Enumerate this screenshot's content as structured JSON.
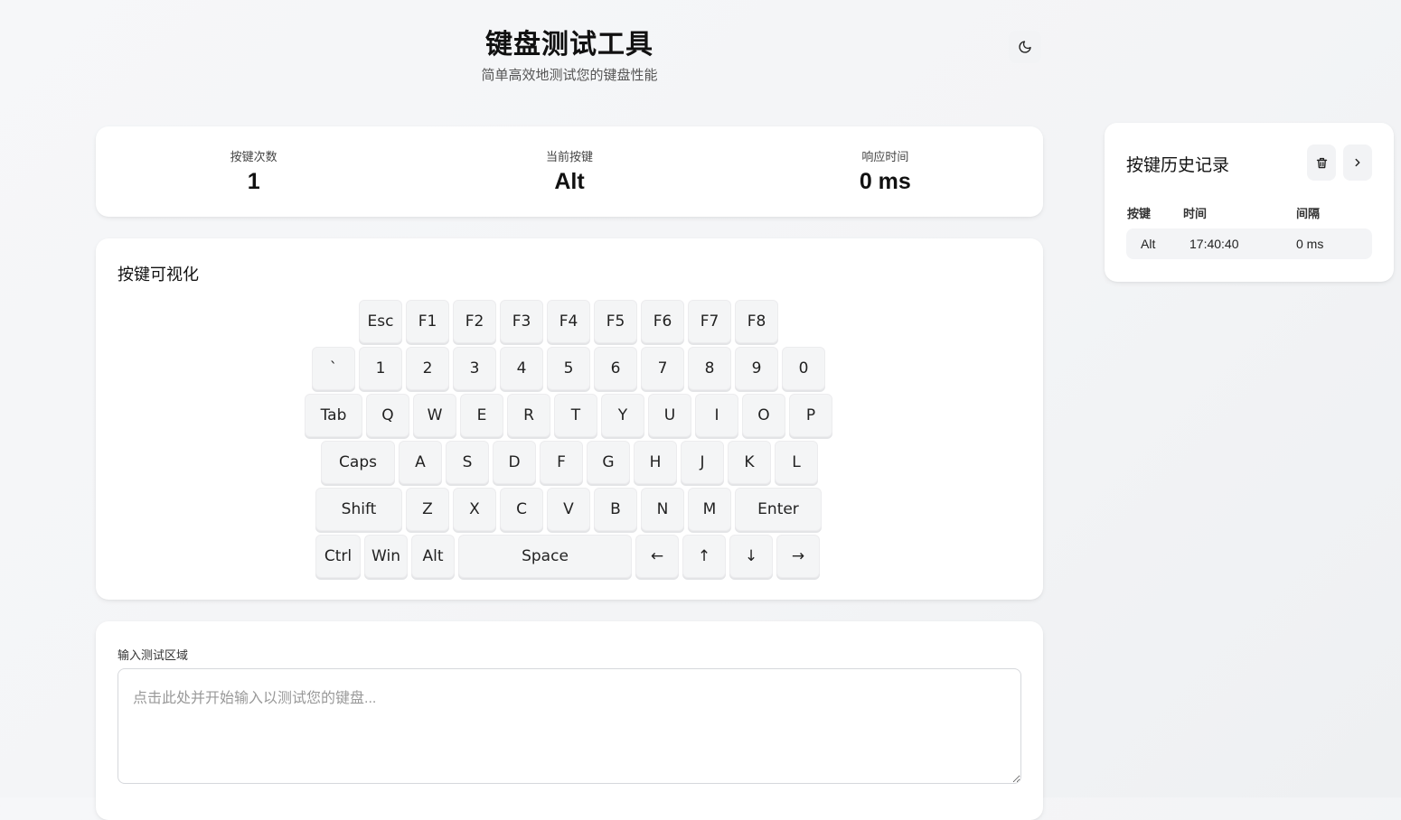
{
  "header": {
    "title": "键盘测试工具",
    "subtitle": "简单高效地测试您的键盘性能",
    "theme_icon": "moon-icon"
  },
  "stats": {
    "count_label": "按键次数",
    "count_value": "1",
    "current_label": "当前按键",
    "current_value": "Alt",
    "response_label": "响应时间",
    "response_value": "0 ms"
  },
  "visualizer": {
    "title": "按键可视化",
    "rows": [
      [
        "Esc",
        "F1",
        "F2",
        "F3",
        "F4",
        "F5",
        "F6",
        "F7",
        "F8"
      ],
      [
        "`",
        "1",
        "2",
        "3",
        "4",
        "5",
        "6",
        "7",
        "8",
        "9",
        "0"
      ],
      [
        "Tab",
        "Q",
        "W",
        "E",
        "R",
        "T",
        "Y",
        "U",
        "I",
        "O",
        "P"
      ],
      [
        "Caps",
        "A",
        "S",
        "D",
        "F",
        "G",
        "H",
        "J",
        "K",
        "L"
      ],
      [
        "Shift",
        "Z",
        "X",
        "C",
        "V",
        "B",
        "N",
        "M",
        "Enter"
      ],
      [
        "Ctrl",
        "Win",
        "Alt",
        "Space",
        "←",
        "↑",
        "↓",
        "→"
      ]
    ]
  },
  "input_area": {
    "label": "输入测试区域",
    "placeholder": "点击此处并开始输入以测试您的键盘...",
    "value": ""
  },
  "history": {
    "title": "按键历史记录",
    "clear_icon": "trash-icon",
    "expand_icon": "chevron-right-icon",
    "columns": [
      "按键",
      "时间",
      "间隔"
    ],
    "rows": [
      {
        "key": "Alt",
        "time": "17:40:40",
        "interval": "0 ms"
      }
    ]
  }
}
